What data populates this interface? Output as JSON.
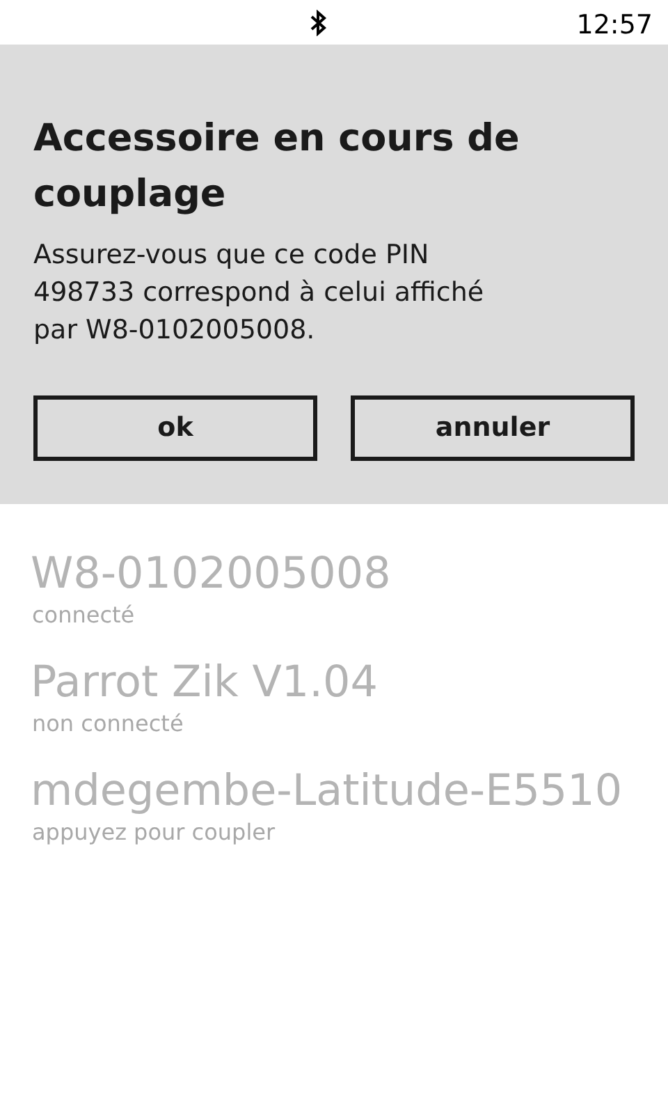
{
  "status_bar": {
    "time": "12:57"
  },
  "dialog": {
    "title": "Accessoire en cours de couplage",
    "message": "Assurez-vous que ce code PIN 498733 correspond à celui affiché par W8-0102005008.",
    "buttons": [
      "ok",
      "annuler"
    ]
  },
  "devices": [
    {
      "name": "W8-0102005008",
      "status": "connecté"
    },
    {
      "name": "Parrot Zik V1.04",
      "status": "non connecté"
    },
    {
      "name": "mdegembe-Latitude-E5510",
      "status": "appuyez pour coupler"
    }
  ]
}
